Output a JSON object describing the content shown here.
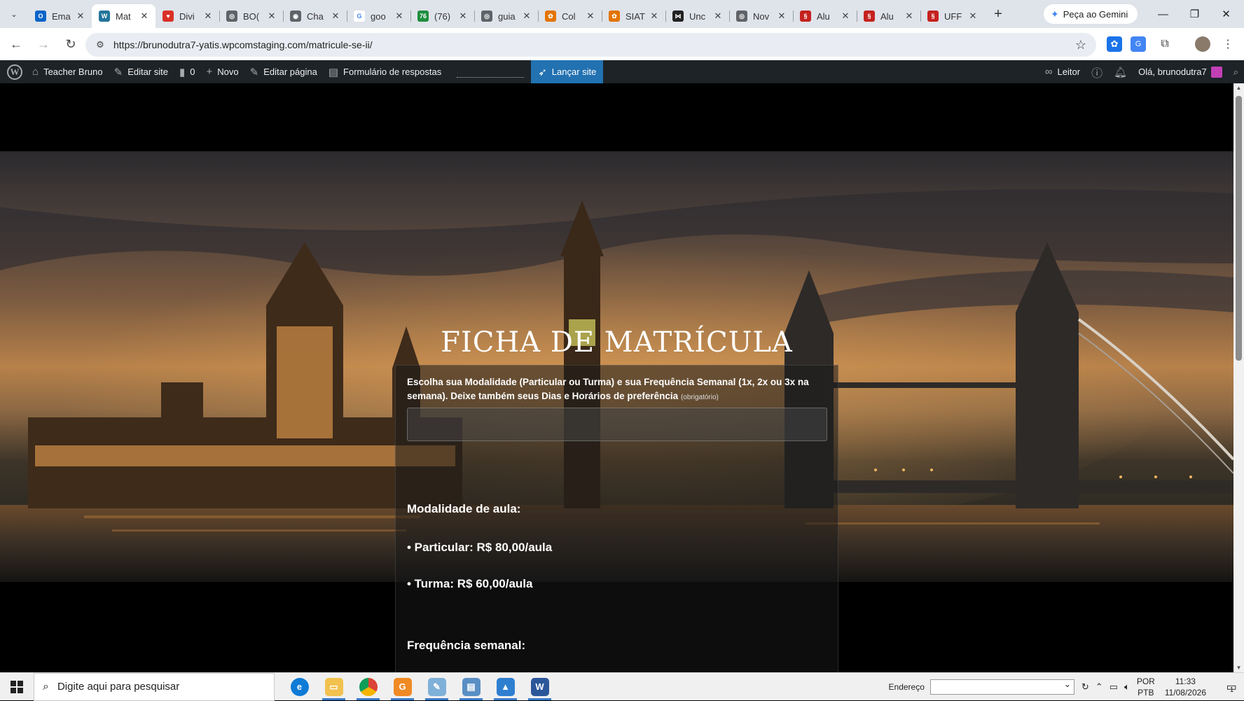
{
  "browser": {
    "tabs": [
      {
        "title": "Ema",
        "fav_color": "#0a64c8",
        "fav_glyph": "O"
      },
      {
        "title": "Mat",
        "fav_color": "#21759b",
        "fav_glyph": "W",
        "active": true
      },
      {
        "title": "Divi",
        "fav_color": "#d93025",
        "fav_glyph": "♥"
      },
      {
        "title": "BO(",
        "fav_color": "#5f6368",
        "fav_glyph": "◎"
      },
      {
        "title": "Cha",
        "fav_color": "#5f6368",
        "fav_glyph": "◉"
      },
      {
        "title": "goo",
        "fav_color": "#ffffff",
        "fav_glyph": "G"
      },
      {
        "title": "(76)",
        "fav_color": "#1e8e3e",
        "fav_glyph": "76"
      },
      {
        "title": "guia",
        "fav_color": "#5f6368",
        "fav_glyph": "◎"
      },
      {
        "title": "Col",
        "fav_color": "#e37400",
        "fav_glyph": "✿"
      },
      {
        "title": "SIAT",
        "fav_color": "#e37400",
        "fav_glyph": "✿"
      },
      {
        "title": "Unc",
        "fav_color": "#222222",
        "fav_glyph": "⋈"
      },
      {
        "title": "Nov",
        "fav_color": "#5f6368",
        "fav_glyph": "◎"
      },
      {
        "title": "Alu",
        "fav_color": "#c5221f",
        "fav_glyph": "§"
      },
      {
        "title": "Alu",
        "fav_color": "#c5221f",
        "fav_glyph": "§"
      },
      {
        "title": "UFF",
        "fav_color": "#c5221f",
        "fav_glyph": "§"
      }
    ],
    "gemini_label": "Peça ao Gemini",
    "url": "https://brunodutra7-yatis.wpcomstaging.com/matricule-se-ii/"
  },
  "adminbar": {
    "site_name": "Teacher Bruno",
    "edit_site": "Editar site",
    "comments_count": "0",
    "new_label": "Novo",
    "edit_page": "Editar página",
    "form_responses": "Formulário de respostas",
    "launch_site": "Lançar site",
    "reader": "Leitor",
    "greeting": "Olá, brunodutra7"
  },
  "page": {
    "title": "FICHA DE MATRÍCULA",
    "question_label": "Escolha sua Modalidade (Particular ou Turma) e sua Frequência Semanal (1x, 2x ou 3x na semana). Deixe também seus Dias e Horários de preferência",
    "required_note": "(obrigatório)",
    "question_value": "",
    "heading_modality": "Modalidade de aula:",
    "item_particular": "• Particular: R$ 80,00/aula",
    "item_turma": "• Turma: R$ 60,00/aula",
    "heading_frequency": "Frequência semanal:"
  },
  "taskbar": {
    "search_placeholder": "Digite aqui para pesquisar",
    "address_label": "Endereço",
    "lang_line1": "POR",
    "lang_line2": "PTB",
    "time": "11:33",
    "date": "11/08/2026",
    "notification_count": "1"
  },
  "colors": {
    "admin_bar_bg": "#1d2327",
    "launch_button": "#2271b1",
    "tab_strip": "#dfe3ea"
  }
}
